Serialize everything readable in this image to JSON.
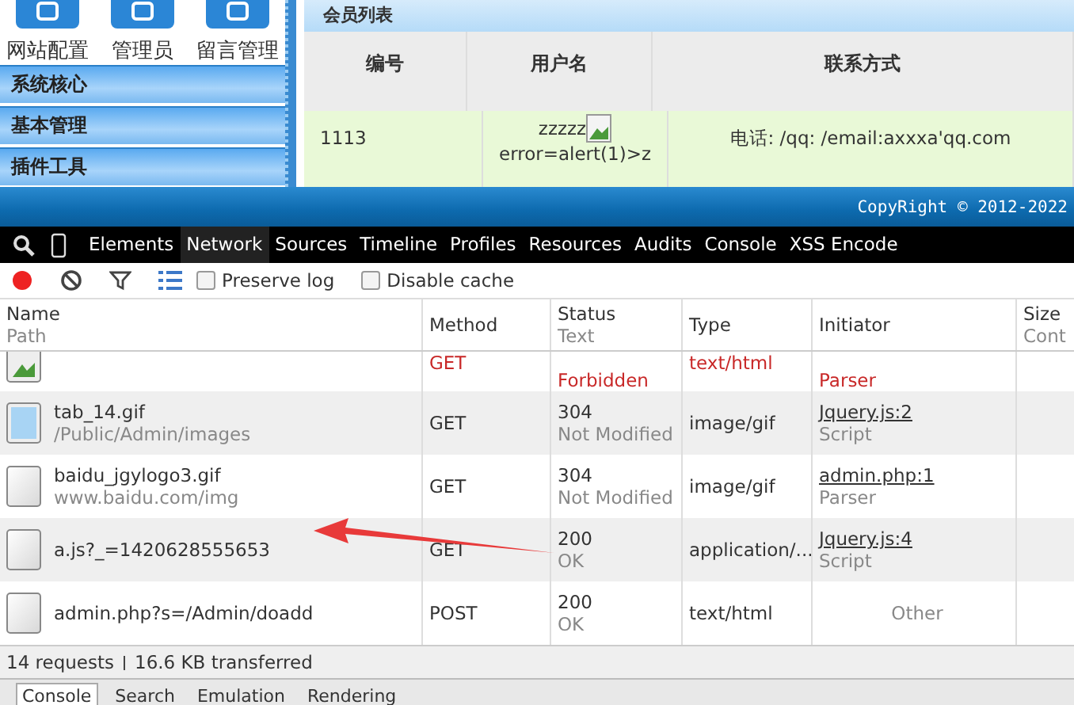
{
  "admin": {
    "shortcuts": [
      {
        "label": "网站配置"
      },
      {
        "label": "管理员"
      },
      {
        "label": "留言管理"
      }
    ],
    "menu": [
      "系统核心",
      "基本管理",
      "插件工具"
    ],
    "panel_title": "会员列表",
    "table": {
      "columns": [
        "编号",
        "用户名",
        "联系方式"
      ],
      "rows": [
        {
          "id": "1113",
          "username": "zzzzz",
          "username_rest": "error=alert(1)>z",
          "contact": "电话: /qq: /email:axxxa'qq.com"
        }
      ]
    },
    "footer": "CopyRight © 2012-2022"
  },
  "devtools": {
    "tabs": [
      {
        "label": "Elements",
        "selected": false
      },
      {
        "label": "Network",
        "selected": true
      },
      {
        "label": "Sources",
        "selected": false
      },
      {
        "label": "Timeline",
        "selected": false
      },
      {
        "label": "Profiles",
        "selected": false
      },
      {
        "label": "Resources",
        "selected": false
      },
      {
        "label": "Audits",
        "selected": false
      },
      {
        "label": "Console",
        "selected": false
      },
      {
        "label": "XSS Encode",
        "selected": false
      }
    ],
    "recording": true,
    "options": [
      {
        "label": "Preserve log",
        "checked": false
      },
      {
        "label": "Disable cache",
        "checked": false
      }
    ],
    "columns": [
      {
        "title": "Name",
        "subtitle": "Path"
      },
      {
        "title": "Method"
      },
      {
        "title": "Status",
        "subtitle": "Text"
      },
      {
        "title": "Type"
      },
      {
        "title": "Initiator"
      },
      {
        "title": "Size",
        "subtitle": "Cont"
      }
    ],
    "requests": [
      {
        "kind": "broken-image",
        "failed": true,
        "method": "GET",
        "status_text": "Forbidden",
        "type": "text/html",
        "initiator_sub": "Parser"
      },
      {
        "kind": "image",
        "failed": false,
        "name": "tab_14.gif",
        "path": "/Public/Admin/images",
        "method": "GET",
        "status": "304",
        "status_text": "Not Modified",
        "type": "image/gif",
        "initiator": "Jquery.js:2",
        "initiator_sub": "Script"
      },
      {
        "kind": "file",
        "failed": false,
        "name": "baidu_jgylogo3.gif",
        "path": "www.baidu.com/img",
        "method": "GET",
        "status": "304",
        "status_text": "Not Modified",
        "type": "image/gif",
        "initiator": "admin.php:1",
        "initiator_sub": "Parser"
      },
      {
        "kind": "file",
        "failed": false,
        "name": "a.js?_=1420628555653",
        "method": "GET",
        "status": "200",
        "status_text": "OK",
        "type": "application/...",
        "initiator": "Jquery.js:4",
        "initiator_sub": "Script"
      },
      {
        "kind": "file",
        "failed": false,
        "name": "admin.php?s=/Admin/doadd",
        "method": "POST",
        "status": "200",
        "status_text": "OK",
        "type": "text/html",
        "initiator_sub": "Other"
      }
    ],
    "summary": [
      "14 requests",
      "16.6 KB transferred"
    ],
    "drawer_tabs": [
      {
        "label": "Console",
        "selected": true
      },
      {
        "label": "Search",
        "selected": false
      },
      {
        "label": "Emulation",
        "selected": false
      },
      {
        "label": "Rendering",
        "selected": false
      }
    ]
  }
}
